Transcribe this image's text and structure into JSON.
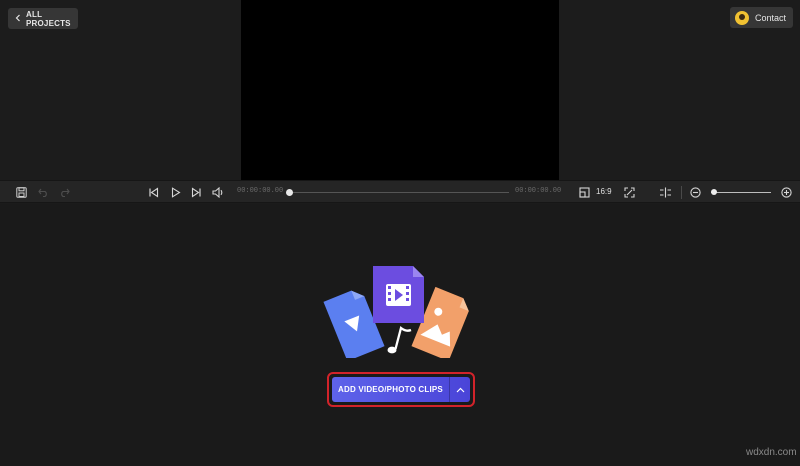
{
  "header": {
    "back_label": "ALL PROJECTS",
    "contact_label": "Contact"
  },
  "toolbar": {
    "current_time": "00:00:00.00",
    "total_time": "00:00:00.00",
    "aspect_ratio": "16:9",
    "icons": [
      "save-icon",
      "undo-icon",
      "redo-icon",
      "skip-back-icon",
      "play-icon",
      "skip-forward-icon",
      "volume-icon",
      "aspect-ratio-icon",
      "fullscreen-icon",
      "split-icon",
      "zoom-out-icon",
      "zoom-in-icon"
    ],
    "playback_progress": 0,
    "zoom_level": 0
  },
  "main": {
    "add_clips_label": "ADD VIDEO/PHOTO CLIPS"
  },
  "watermark": "wdxdn.com",
  "colors": {
    "accent": "#5e63ea",
    "highlight": "#d2232a",
    "card_blue": "#5b7ff0",
    "card_purple": "#6c4de0",
    "card_orange": "#f2a06a"
  }
}
